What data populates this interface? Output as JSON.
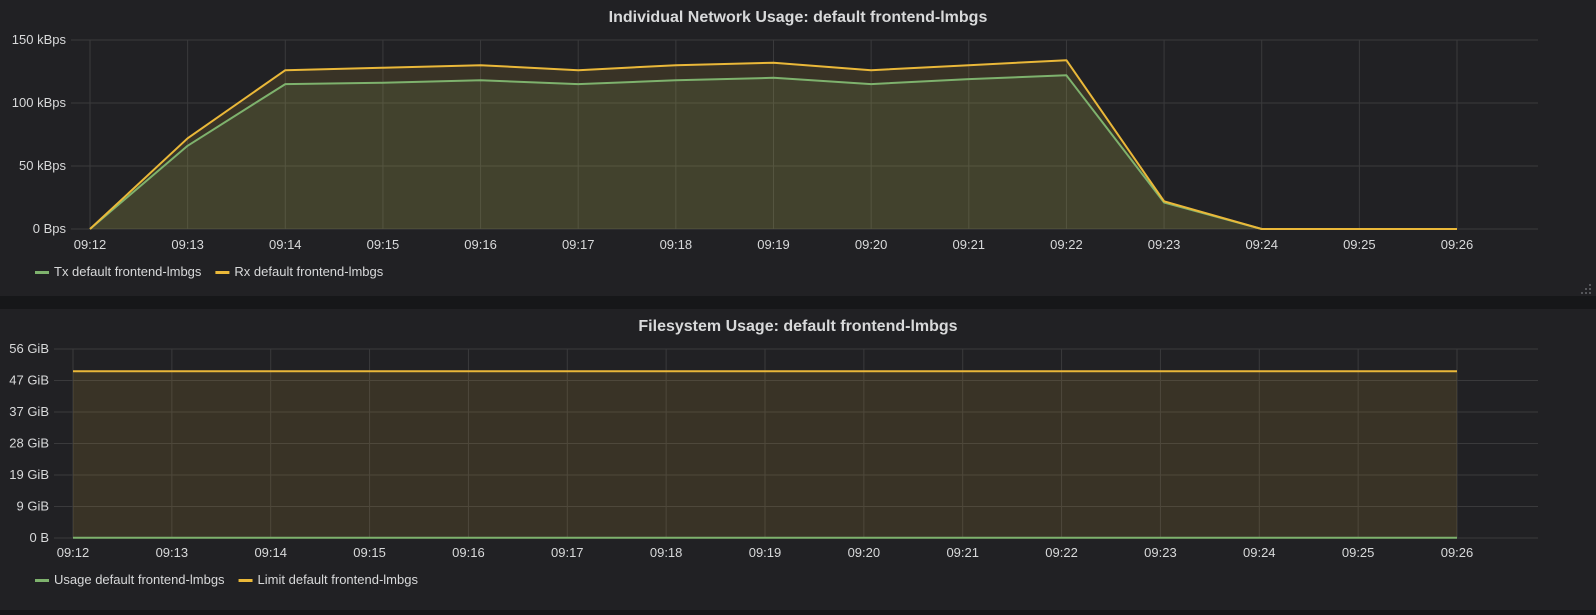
{
  "colors": {
    "tx": "#7eb26d",
    "rx": "#eab839",
    "grid": "#3a3a3c",
    "text": "#d8d9da",
    "panel": "#212124",
    "background": "#161719"
  },
  "chart_data": [
    {
      "type": "area",
      "title": "Individual Network Usage: default frontend-lmbgs",
      "x": [
        "09:12",
        "09:13",
        "09:14",
        "09:15",
        "09:16",
        "09:17",
        "09:18",
        "09:19",
        "09:20",
        "09:21",
        "09:22",
        "09:23",
        "09:24",
        "09:25",
        "09:26"
      ],
      "yticks": [
        {
          "value": 0,
          "label": "0 Bps"
        },
        {
          "value": 50,
          "label": "50 kBps"
        },
        {
          "value": 100,
          "label": "100 kBps"
        },
        {
          "value": 150,
          "label": "150 kBps"
        }
      ],
      "ylim": [
        0,
        150
      ],
      "unit": "kBps",
      "grid": true,
      "legend": "bottom-left",
      "series": [
        {
          "name": "Tx default frontend-lmbgs",
          "color": "#7eb26d",
          "fill": true,
          "values": [
            0,
            66,
            115,
            116,
            118,
            115,
            118,
            120,
            115,
            119,
            122,
            21,
            0,
            0,
            0
          ]
        },
        {
          "name": "Rx default frontend-lmbgs",
          "color": "#eab839",
          "fill": true,
          "values": [
            0,
            72,
            126,
            128,
            130,
            126,
            130,
            132,
            126,
            130,
            134,
            22,
            0,
            0,
            0
          ]
        }
      ]
    },
    {
      "type": "area",
      "title": "Filesystem Usage: default frontend-lmbgs",
      "x": [
        "09:12",
        "09:13",
        "09:14",
        "09:15",
        "09:16",
        "09:17",
        "09:18",
        "09:19",
        "09:20",
        "09:21",
        "09:22",
        "09:23",
        "09:24",
        "09:25",
        "09:26"
      ],
      "yticks": [
        {
          "value": 0,
          "label": "0 B"
        },
        {
          "value": 9.33,
          "label": "9 GiB"
        },
        {
          "value": 18.67,
          "label": "19 GiB"
        },
        {
          "value": 28,
          "label": "28 GiB"
        },
        {
          "value": 37.33,
          "label": "37 GiB"
        },
        {
          "value": 46.67,
          "label": "47 GiB"
        },
        {
          "value": 56,
          "label": "56 GiB"
        }
      ],
      "ylim": [
        0,
        56
      ],
      "unit": "GiB",
      "grid": true,
      "legend": "bottom-left",
      "series": [
        {
          "name": "Usage default frontend-lmbgs",
          "color": "#7eb26d",
          "fill": true,
          "values": [
            0.05,
            0.05,
            0.05,
            0.05,
            0.05,
            0.05,
            0.05,
            0.05,
            0.05,
            0.05,
            0.05,
            0.05,
            0.05,
            0.05,
            0.05
          ]
        },
        {
          "name": "Limit default frontend-lmbgs",
          "color": "#eab839",
          "fill": true,
          "values": [
            49.4,
            49.4,
            49.4,
            49.4,
            49.4,
            49.4,
            49.4,
            49.4,
            49.4,
            49.4,
            49.4,
            49.4,
            49.4,
            49.4,
            49.4
          ]
        }
      ]
    }
  ]
}
